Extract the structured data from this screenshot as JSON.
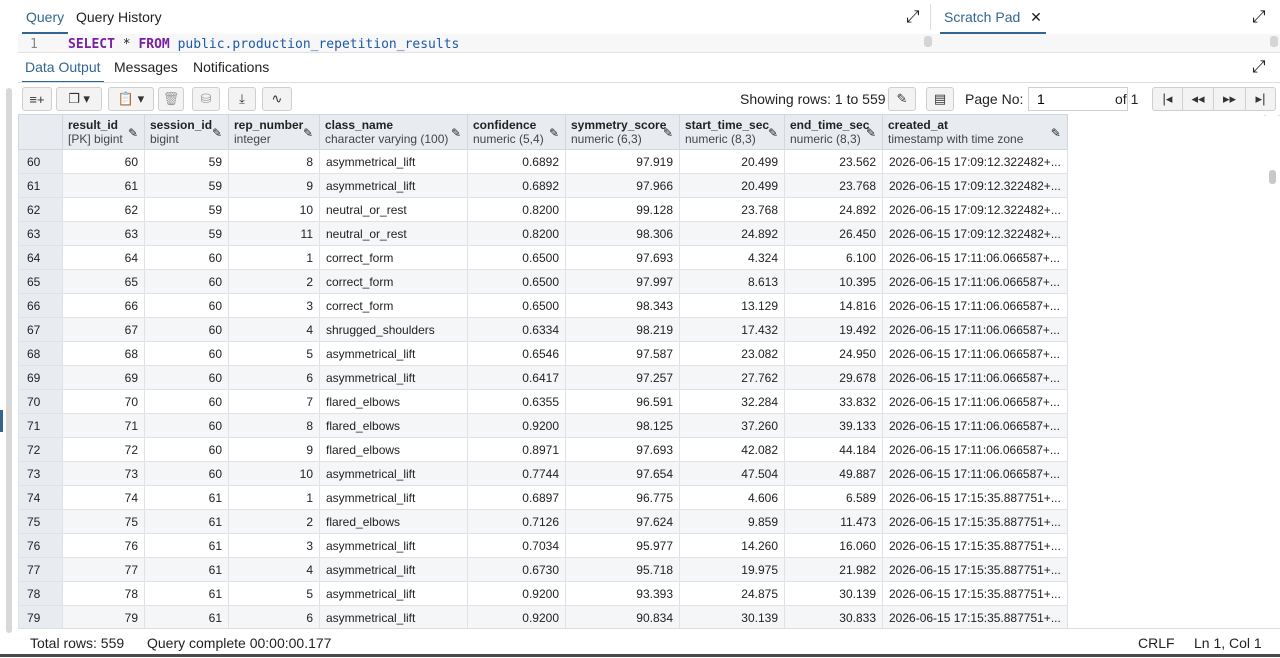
{
  "editor_tabs": {
    "query": "Query",
    "history": "Query History",
    "scratch": "Scratch Pad",
    "scratch_close": "✕",
    "expand_icon": "⤢"
  },
  "editor": {
    "line_no": "1",
    "kw1": "SELECT",
    "star": " * ",
    "kw2": "FROM",
    "ident": " public.production_repetition_results"
  },
  "result_tabs": {
    "data_output": "Data Output",
    "messages": "Messages",
    "notifications": "Notifications"
  },
  "toolbar": {
    "showing": "Showing rows: 1 to 559",
    "page_label": "Page No:",
    "page_value": "1",
    "of": "of 1"
  },
  "columns": [
    {
      "name": "result_id",
      "type": "[PK] bigint"
    },
    {
      "name": "session_id",
      "type": "bigint"
    },
    {
      "name": "rep_number",
      "type": "integer"
    },
    {
      "name": "class_name",
      "type": "character varying (100)"
    },
    {
      "name": "confidence",
      "type": "numeric (5,4)"
    },
    {
      "name": "symmetry_score",
      "type": "numeric (6,3)"
    },
    {
      "name": "start_time_sec",
      "type": "numeric (8,3)"
    },
    {
      "name": "end_time_sec",
      "type": "numeric (8,3)"
    },
    {
      "name": "created_at",
      "type": "timestamp with time zone"
    }
  ],
  "rows": [
    [
      "60",
      "60",
      "59",
      "8",
      "asymmetrical_lift",
      "0.6892",
      "97.919",
      "20.499",
      "23.562",
      "2026-06-15 17:09:12.322482+..."
    ],
    [
      "61",
      "61",
      "59",
      "9",
      "asymmetrical_lift",
      "0.6892",
      "97.966",
      "20.499",
      "23.768",
      "2026-06-15 17:09:12.322482+..."
    ],
    [
      "62",
      "62",
      "59",
      "10",
      "neutral_or_rest",
      "0.8200",
      "99.128",
      "23.768",
      "24.892",
      "2026-06-15 17:09:12.322482+..."
    ],
    [
      "63",
      "63",
      "59",
      "11",
      "neutral_or_rest",
      "0.8200",
      "98.306",
      "24.892",
      "26.450",
      "2026-06-15 17:09:12.322482+..."
    ],
    [
      "64",
      "64",
      "60",
      "1",
      "correct_form",
      "0.6500",
      "97.693",
      "4.324",
      "6.100",
      "2026-06-15 17:11:06.066587+..."
    ],
    [
      "65",
      "65",
      "60",
      "2",
      "correct_form",
      "0.6500",
      "97.997",
      "8.613",
      "10.395",
      "2026-06-15 17:11:06.066587+..."
    ],
    [
      "66",
      "66",
      "60",
      "3",
      "correct_form",
      "0.6500",
      "98.343",
      "13.129",
      "14.816",
      "2026-06-15 17:11:06.066587+..."
    ],
    [
      "67",
      "67",
      "60",
      "4",
      "shrugged_shoulders",
      "0.6334",
      "98.219",
      "17.432",
      "19.492",
      "2026-06-15 17:11:06.066587+..."
    ],
    [
      "68",
      "68",
      "60",
      "5",
      "asymmetrical_lift",
      "0.6546",
      "97.587",
      "23.082",
      "24.950",
      "2026-06-15 17:11:06.066587+..."
    ],
    [
      "69",
      "69",
      "60",
      "6",
      "asymmetrical_lift",
      "0.6417",
      "97.257",
      "27.762",
      "29.678",
      "2026-06-15 17:11:06.066587+..."
    ],
    [
      "70",
      "70",
      "60",
      "7",
      "flared_elbows",
      "0.6355",
      "96.591",
      "32.284",
      "33.832",
      "2026-06-15 17:11:06.066587+..."
    ],
    [
      "71",
      "71",
      "60",
      "8",
      "flared_elbows",
      "0.9200",
      "98.125",
      "37.260",
      "39.133",
      "2026-06-15 17:11:06.066587+..."
    ],
    [
      "72",
      "72",
      "60",
      "9",
      "flared_elbows",
      "0.8971",
      "97.693",
      "42.082",
      "44.184",
      "2026-06-15 17:11:06.066587+..."
    ],
    [
      "73",
      "73",
      "60",
      "10",
      "asymmetrical_lift",
      "0.7744",
      "97.654",
      "47.504",
      "49.887",
      "2026-06-15 17:11:06.066587+..."
    ],
    [
      "74",
      "74",
      "61",
      "1",
      "asymmetrical_lift",
      "0.6897",
      "96.775",
      "4.606",
      "6.589",
      "2026-06-15 17:15:35.887751+..."
    ],
    [
      "75",
      "75",
      "61",
      "2",
      "flared_elbows",
      "0.7126",
      "97.624",
      "9.859",
      "11.473",
      "2026-06-15 17:15:35.887751+..."
    ],
    [
      "76",
      "76",
      "61",
      "3",
      "asymmetrical_lift",
      "0.7034",
      "95.977",
      "14.260",
      "16.060",
      "2026-06-15 17:15:35.887751+..."
    ],
    [
      "77",
      "77",
      "61",
      "4",
      "asymmetrical_lift",
      "0.6730",
      "95.718",
      "19.975",
      "21.982",
      "2026-06-15 17:15:35.887751+..."
    ],
    [
      "78",
      "78",
      "61",
      "5",
      "asymmetrical_lift",
      "0.9200",
      "93.393",
      "24.875",
      "30.139",
      "2026-06-15 17:15:35.887751+..."
    ],
    [
      "79",
      "79",
      "61",
      "6",
      "asymmetrical_lift",
      "0.9200",
      "90.834",
      "30.139",
      "30.833",
      "2026-06-15 17:15:35.887751+..."
    ]
  ],
  "status": {
    "total_rows": "Total rows: 559",
    "query_complete": "Query complete 00:00:00.177",
    "line_ending": "CRLF",
    "cursor": "Ln 1, Col 1"
  },
  "colors": {
    "accent": "#326690",
    "header_bg": "#e8ecf1"
  }
}
